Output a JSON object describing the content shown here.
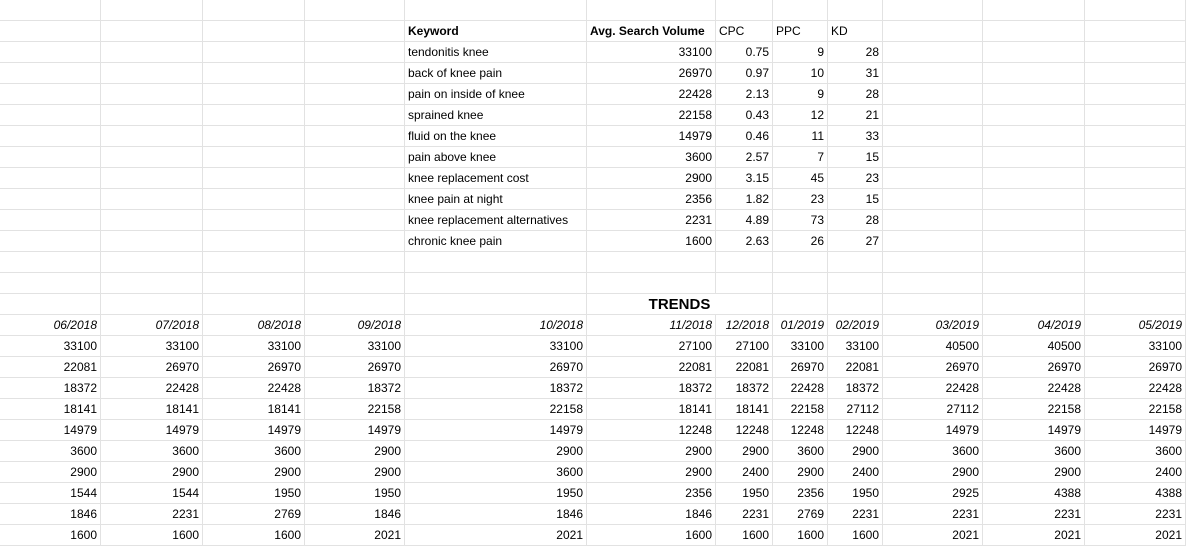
{
  "keywords": {
    "headers": [
      "Keyword",
      "Avg. Search Volume",
      "CPC",
      "PPC",
      "KD"
    ],
    "rows": [
      [
        "tendonitis knee",
        "33100",
        "0.75",
        "9",
        "28"
      ],
      [
        "back of knee pain",
        "26970",
        "0.97",
        "10",
        "31"
      ],
      [
        "pain on inside of knee",
        "22428",
        "2.13",
        "9",
        "28"
      ],
      [
        "sprained knee",
        "22158",
        "0.43",
        "12",
        "21"
      ],
      [
        "fluid on the knee",
        "14979",
        "0.46",
        "11",
        "33"
      ],
      [
        "pain above knee",
        "3600",
        "2.57",
        "7",
        "15"
      ],
      [
        "knee replacement cost",
        "2900",
        "3.15",
        "45",
        "23"
      ],
      [
        "knee pain at night",
        "2356",
        "1.82",
        "23",
        "15"
      ],
      [
        "knee replacement alternatives",
        "2231",
        "4.89",
        "73",
        "28"
      ],
      [
        "chronic knee pain",
        "1600",
        "2.63",
        "26",
        "27"
      ]
    ]
  },
  "trends": {
    "title": "TRENDS",
    "months": [
      "06/2018",
      "07/2018",
      "08/2018",
      "09/2018",
      "10/2018",
      "11/2018",
      "12/2018",
      "01/2019",
      "02/2019",
      "03/2019",
      "04/2019",
      "05/2019"
    ],
    "rows": [
      [
        "33100",
        "33100",
        "33100",
        "33100",
        "33100",
        "27100",
        "27100",
        "33100",
        "33100",
        "40500",
        "40500",
        "33100"
      ],
      [
        "22081",
        "26970",
        "26970",
        "26970",
        "26970",
        "22081",
        "22081",
        "26970",
        "22081",
        "26970",
        "26970",
        "26970"
      ],
      [
        "18372",
        "22428",
        "22428",
        "18372",
        "18372",
        "18372",
        "18372",
        "22428",
        "18372",
        "22428",
        "22428",
        "22428"
      ],
      [
        "18141",
        "18141",
        "18141",
        "22158",
        "22158",
        "18141",
        "18141",
        "22158",
        "27112",
        "27112",
        "22158",
        "22158"
      ],
      [
        "14979",
        "14979",
        "14979",
        "14979",
        "14979",
        "12248",
        "12248",
        "12248",
        "12248",
        "14979",
        "14979",
        "14979"
      ],
      [
        "3600",
        "3600",
        "3600",
        "2900",
        "2900",
        "2900",
        "2900",
        "3600",
        "2900",
        "3600",
        "3600",
        "3600"
      ],
      [
        "2900",
        "2900",
        "2900",
        "2900",
        "3600",
        "2900",
        "2400",
        "2900",
        "2400",
        "2900",
        "2900",
        "2400"
      ],
      [
        "1544",
        "1544",
        "1950",
        "1950",
        "1950",
        "2356",
        "1950",
        "2356",
        "1950",
        "2925",
        "4388",
        "4388"
      ],
      [
        "1846",
        "2231",
        "2769",
        "1846",
        "1846",
        "1846",
        "2231",
        "2769",
        "2231",
        "2231",
        "2231",
        "2231"
      ],
      [
        "1600",
        "1600",
        "1600",
        "2021",
        "2021",
        "1600",
        "1600",
        "1600",
        "1600",
        "2021",
        "2021",
        "2021"
      ]
    ]
  }
}
